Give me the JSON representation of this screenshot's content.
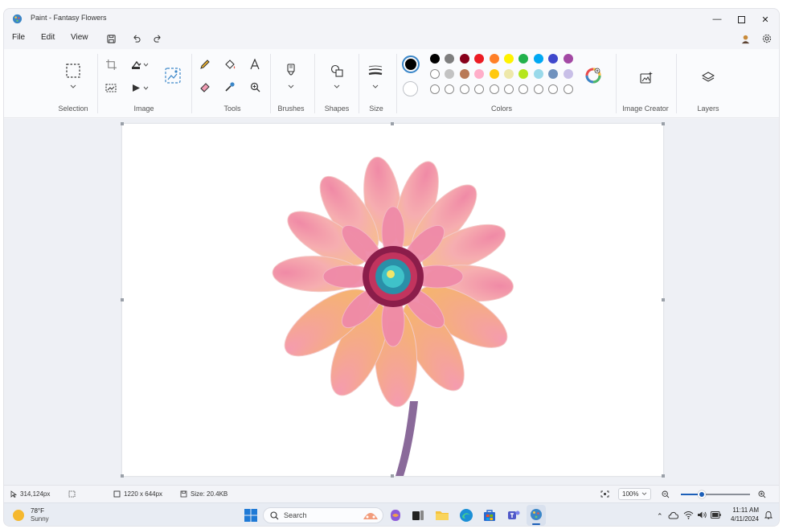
{
  "window": {
    "title": "Paint - Fantasy Flowers"
  },
  "menu": {
    "file": "File",
    "edit": "Edit",
    "view": "View"
  },
  "ribbon": {
    "groups": {
      "selection": "Selection",
      "image": "Image",
      "tools": "Tools",
      "brushes": "Brushes",
      "shapes": "Shapes",
      "size": "Size",
      "colors": "Colors",
      "image_creator": "Image Creator",
      "layers": "Layers"
    },
    "palette_row1": [
      "#000000",
      "#7f7f7f",
      "#88001b",
      "#ec1c24",
      "#ff7f27",
      "#fff200",
      "#22b14c",
      "#00a8f3",
      "#3f48cc",
      "#a349a4"
    ],
    "palette_row2": [
      "#ffffff",
      "#c3c3c3",
      "#b97a57",
      "#ffaec9",
      "#ffc90e",
      "#eee8aa",
      "#b5e61d",
      "#99d9ea",
      "#7092be",
      "#c8bfe7"
    ],
    "primary_color": "#000000",
    "secondary_color": "#ffffff"
  },
  "status": {
    "cursor": "314,124px",
    "dimensions": "1220 x 644px",
    "size": "Size: 20.4KB",
    "zoom": "100%",
    "zoom_level": 0.3
  },
  "taskbar": {
    "weather_temp": "78°F",
    "weather_desc": "Sunny",
    "search_placeholder": "Search",
    "time": "11:11 AM",
    "date": "4/11/2024"
  }
}
